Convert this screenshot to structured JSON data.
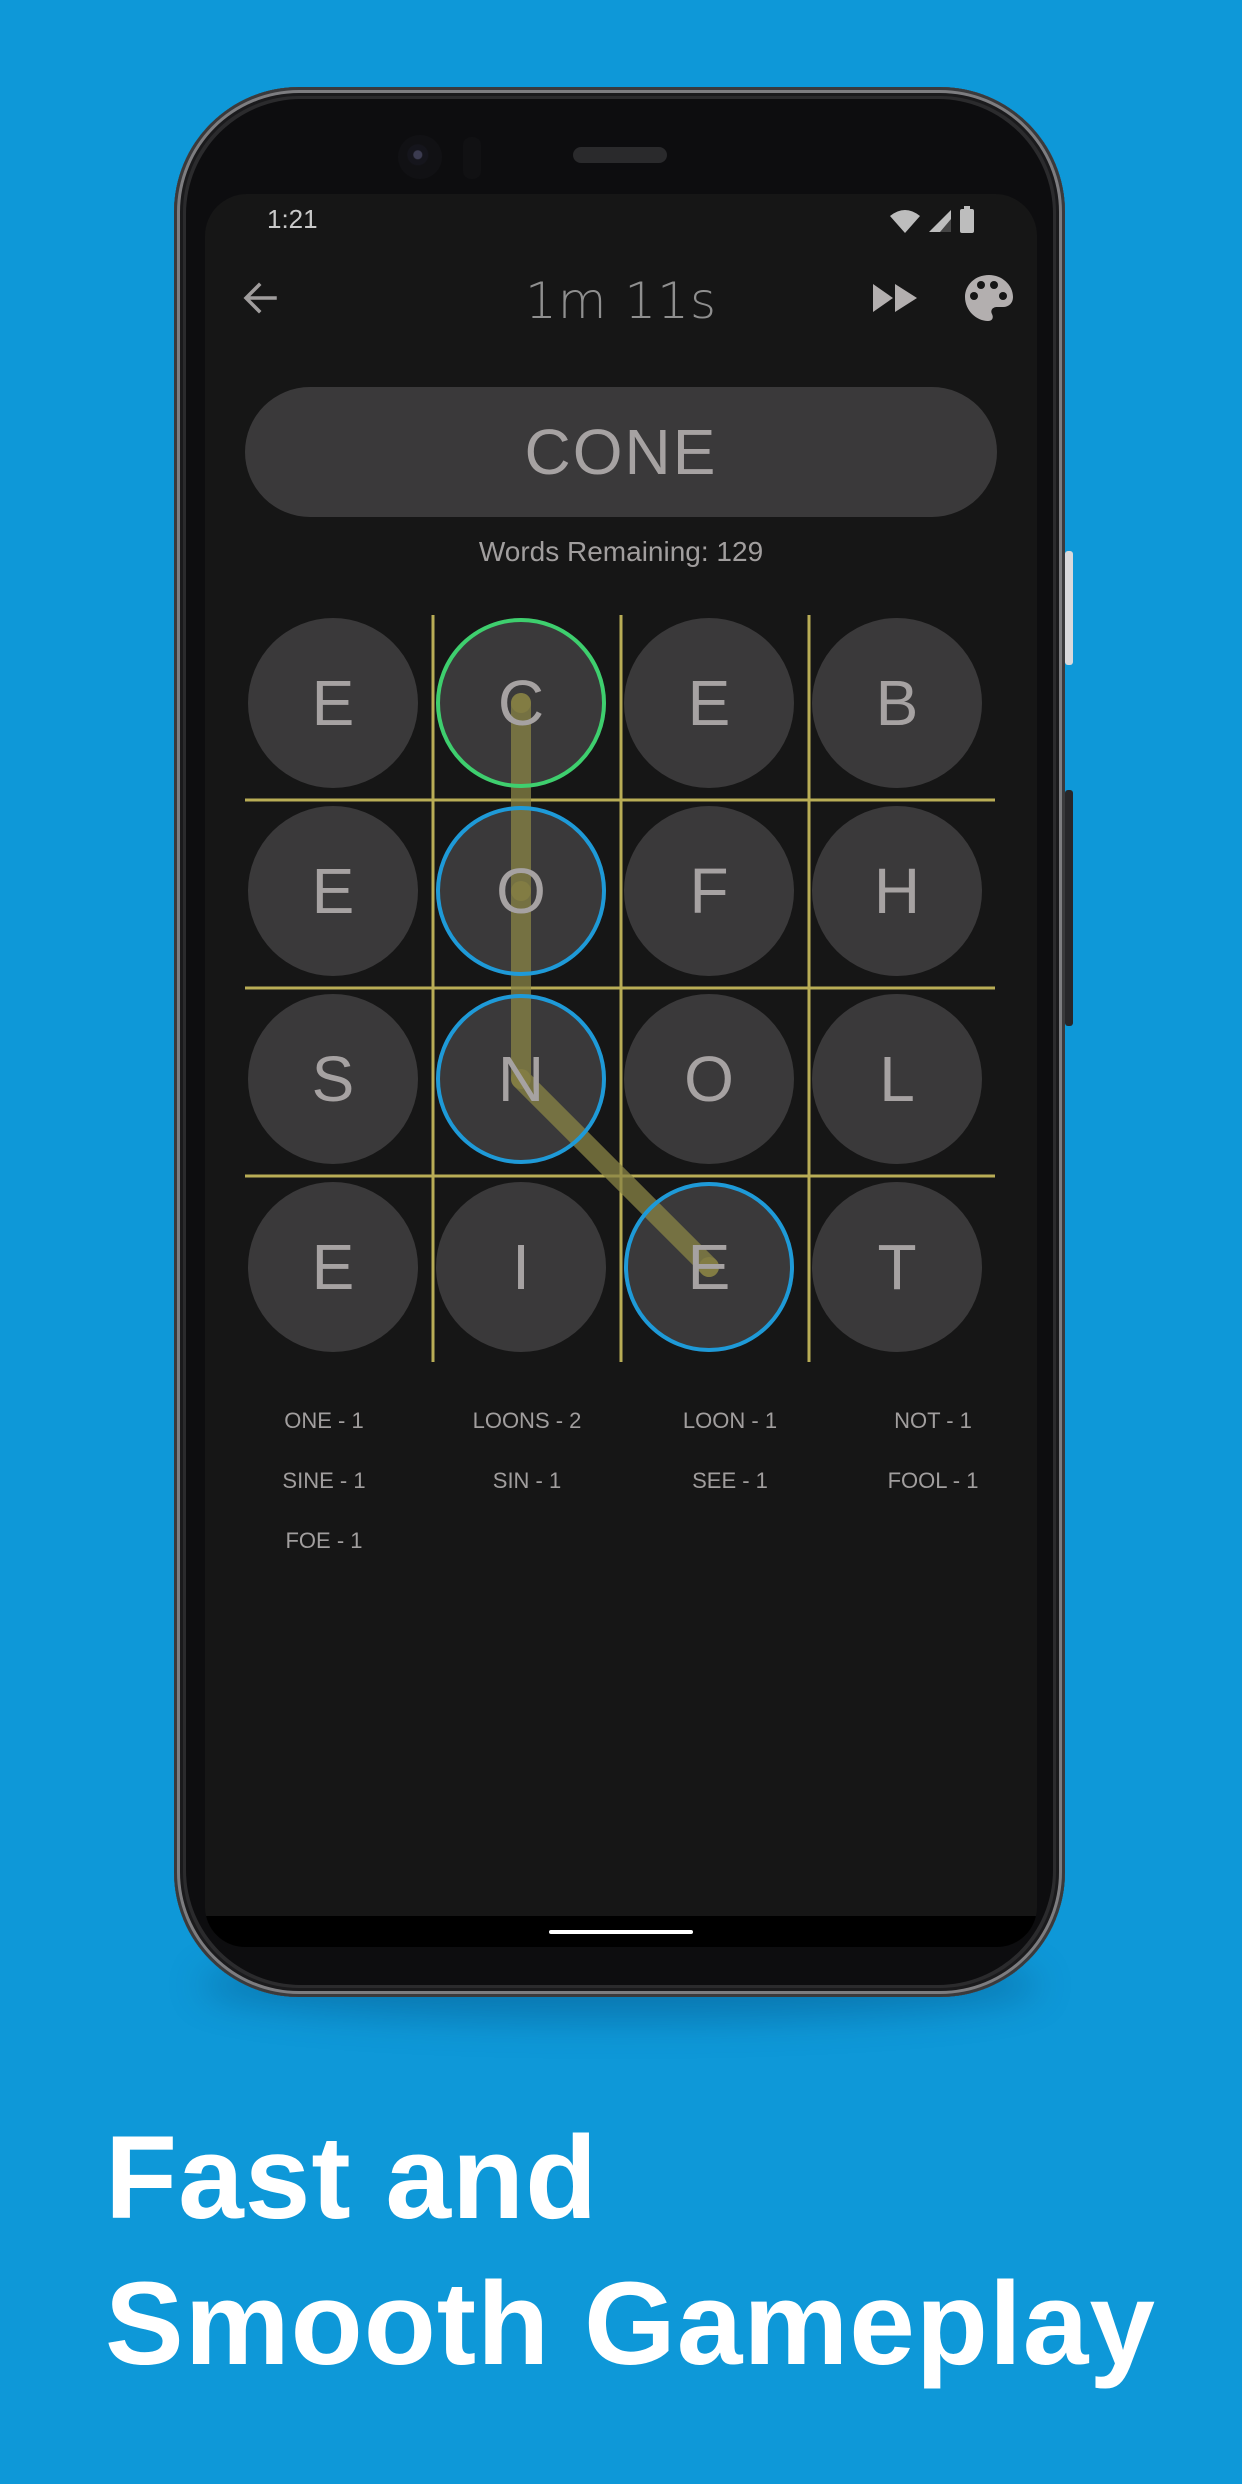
{
  "colors": {
    "background": "#0E98D8",
    "screen": "#161616",
    "tile": "#3a393a",
    "letter": "#a6a2a2",
    "grid_line": "#b9ad56",
    "trail": "#8a8445",
    "start_ring": "#3ecf6e",
    "path_ring": "#1e9ad8"
  },
  "status_bar": {
    "time": "1:21",
    "icons": [
      "wifi-icon",
      "signal-icon",
      "battery-icon"
    ]
  },
  "toolbar": {
    "back_icon": "arrow-left-icon",
    "timer": "1m 11s",
    "skip_icon": "fast-forward-icon",
    "theme_icon": "palette-icon"
  },
  "game": {
    "current_word": "CONE",
    "words_remaining_label": "Words Remaining: 129",
    "board": [
      [
        "E",
        "C",
        "E",
        "B"
      ],
      [
        "E",
        "O",
        "F",
        "H"
      ],
      [
        "S",
        "N",
        "O",
        "L"
      ],
      [
        "E",
        "I",
        "E",
        "T"
      ]
    ],
    "selected_path": [
      [
        0,
        1
      ],
      [
        1,
        1
      ],
      [
        2,
        1
      ],
      [
        3,
        2
      ]
    ],
    "found_words": [
      "ONE - 1",
      "LOONS - 2",
      "LOON - 1",
      "NOT - 1",
      "SINE - 1",
      "SIN - 1",
      "SEE - 1",
      "FOOL - 1",
      "FOE - 1"
    ]
  },
  "promo": {
    "line1": "Fast and",
    "line2": "Smooth Gameplay"
  }
}
